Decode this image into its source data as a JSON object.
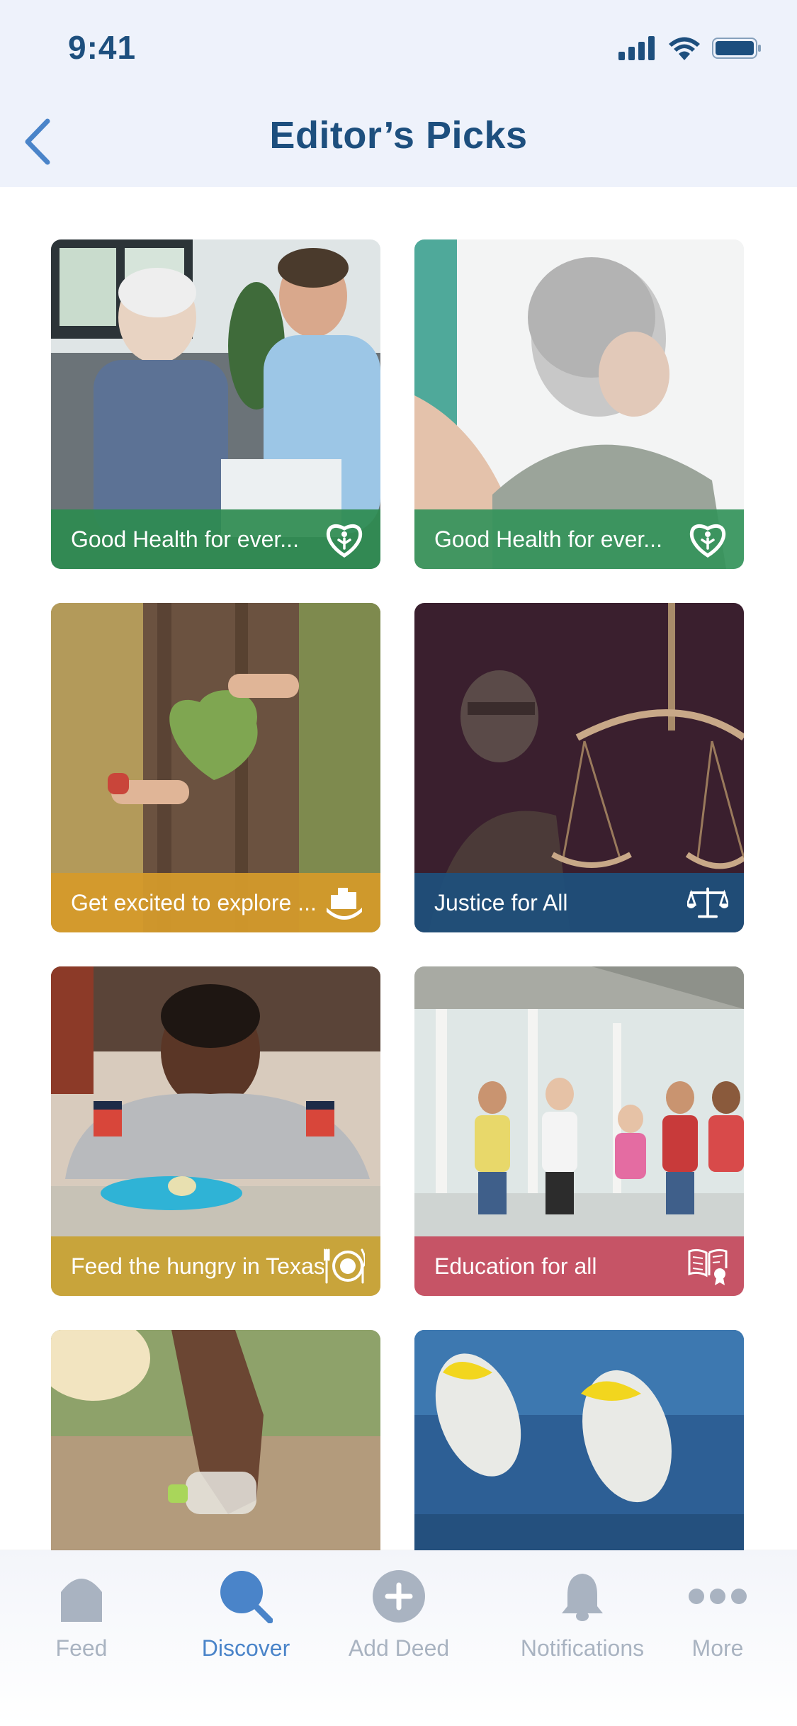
{
  "status_bar": {
    "time": "9:41"
  },
  "header": {
    "title": "Editor’s Picks"
  },
  "cards": [
    {
      "label": "Good Health for ever...",
      "color": "#2e8b50",
      "icon": "heart-person-icon"
    },
    {
      "label": "Good Health for ever...",
      "color": "#34935a",
      "icon": "heart-person-icon"
    },
    {
      "label": "Get excited to explore ...",
      "color": "#d49a2a",
      "icon": "city-hands-icon"
    },
    {
      "label": "Justice for All",
      "color": "#1f4f7a",
      "icon": "scales-icon"
    },
    {
      "label": "Feed the hungry in Texas",
      "color": "#c8a233",
      "icon": "plate-utensils-icon"
    },
    {
      "label": "Education for all",
      "color": "#c64b5f",
      "icon": "book-award-icon"
    },
    {
      "label": "",
      "color": "",
      "icon": ""
    },
    {
      "label": "",
      "color": "",
      "icon": ""
    }
  ],
  "tab_bar": {
    "tabs": [
      {
        "label": "Feed",
        "icon": "home-icon"
      },
      {
        "label": "Discover",
        "icon": "search-icon",
        "active": true
      },
      {
        "label": "Add Deed",
        "icon": "plus-circle-icon"
      },
      {
        "label": "Notifications",
        "icon": "bell-icon"
      },
      {
        "label": "More",
        "icon": "more-dots-icon"
      }
    ]
  },
  "colors": {
    "primary": "#1d4f7e",
    "accent": "#4a84c9",
    "inactive": "#a9b3c1",
    "header_bg": "#eef2fb"
  }
}
